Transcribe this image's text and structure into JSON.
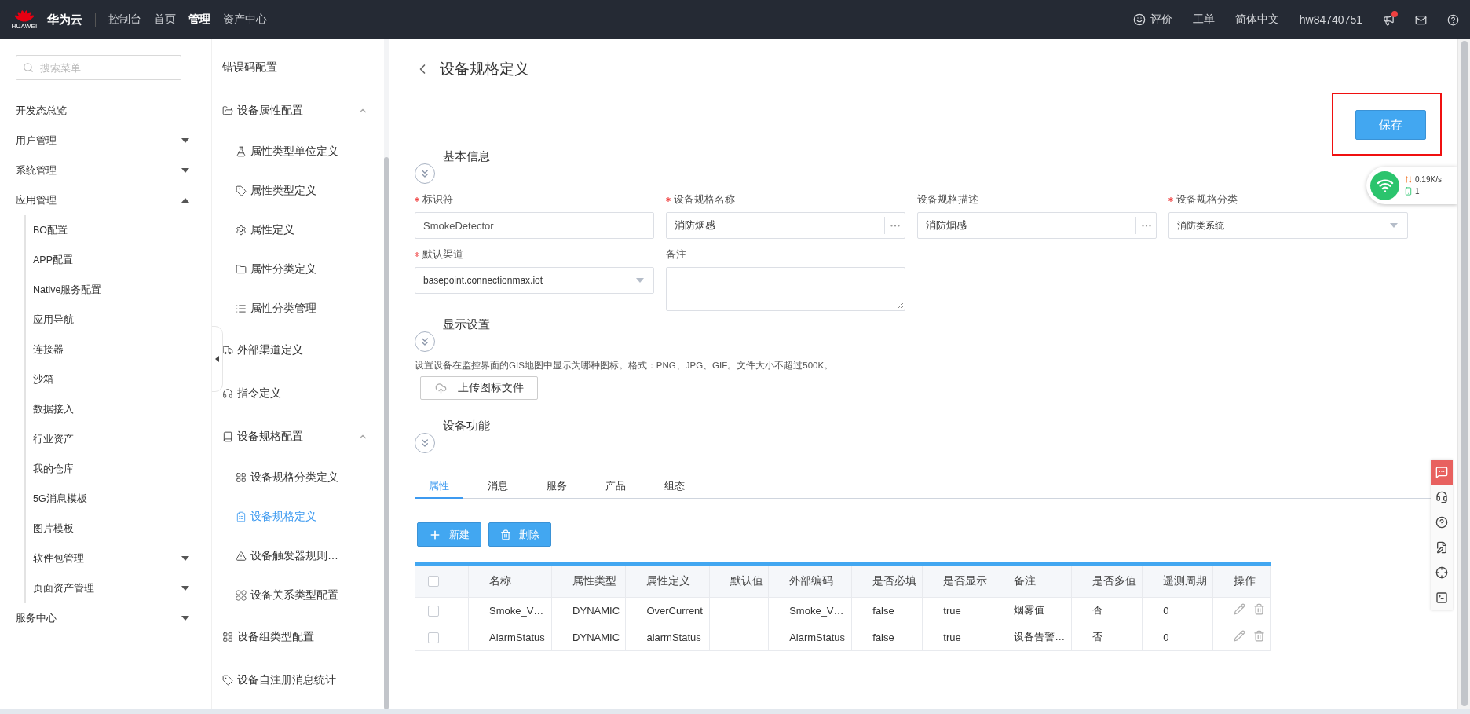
{
  "topbar": {
    "logo_text": "HUAWEI",
    "brand": "华为云",
    "nav": [
      {
        "label": "控制台",
        "selected": false
      },
      {
        "label": "首页",
        "selected": false
      },
      {
        "label": "管理",
        "selected": true
      },
      {
        "label": "资产中心",
        "selected": false
      }
    ],
    "links": [
      "评价",
      "工单",
      "简体中文",
      "hw84740751"
    ],
    "notification_dot": true
  },
  "sidebar": {
    "search_placeholder": "搜索菜单",
    "items": [
      {
        "label": "开发态总览"
      },
      {
        "label": "用户管理",
        "expanded": false
      },
      {
        "label": "系统管理",
        "expanded": false
      },
      {
        "label": "应用管理",
        "expanded": true,
        "children": [
          {
            "label": "BO配置"
          },
          {
            "label": "APP配置"
          },
          {
            "label": "Native服务配置"
          },
          {
            "label": "应用导航"
          },
          {
            "label": "连接器"
          },
          {
            "label": "沙箱"
          },
          {
            "label": "数据接入"
          },
          {
            "label": "行业资产"
          },
          {
            "label": "我的仓库"
          },
          {
            "label": "5G消息模板"
          },
          {
            "label": "图片模板"
          },
          {
            "label": "软件包管理",
            "expanded": false
          },
          {
            "label": "页面资产管理",
            "expanded": false
          }
        ]
      },
      {
        "label": "服务中心",
        "expanded": false
      }
    ]
  },
  "subnav": {
    "items": [
      {
        "label": "错误码配置",
        "selected": false
      },
      {
        "label": "设备属性配置",
        "selected": false,
        "expanded": true,
        "children": [
          {
            "label": "属性类型单位定义",
            "selected": false
          },
          {
            "label": "属性类型定义",
            "selected": false
          },
          {
            "label": "属性定义",
            "selected": false
          },
          {
            "label": "属性分类定义",
            "selected": false
          },
          {
            "label": "属性分类管理",
            "selected": false
          }
        ]
      },
      {
        "label": "外部渠道定义",
        "selected": false
      },
      {
        "label": "指令定义",
        "selected": false
      },
      {
        "label": "设备规格配置",
        "selected": false,
        "expanded": true,
        "children": [
          {
            "label": "设备规格分类定义",
            "selected": false
          },
          {
            "label": "设备规格定义",
            "selected": true
          },
          {
            "label": "设备触发器规则…",
            "selected": false
          },
          {
            "label": "设备关系类型配置",
            "selected": false
          }
        ]
      },
      {
        "label": "设备组类型配置",
        "selected": false
      },
      {
        "label": "设备自注册消息统计",
        "selected": false
      }
    ]
  },
  "page": {
    "title": "设备规格定义",
    "save_button": {
      "label": "保存",
      "highlighted": true
    },
    "network_widget": {
      "speed": "0.19K/s",
      "count": "1"
    },
    "basic": {
      "title": "基本信息",
      "fields": [
        {
          "label": "标识符",
          "required": true,
          "kind": "text",
          "value": "SmokeDetector",
          "disabled": true
        },
        {
          "label": "设备规格名称",
          "required": true,
          "kind": "picker",
          "value": "消防烟感",
          "disabled": false
        },
        {
          "label": "设备规格描述",
          "required": false,
          "kind": "picker",
          "value": "消防烟感",
          "disabled": false
        },
        {
          "label": "设备规格分类",
          "required": true,
          "kind": "select",
          "value": "消防类系统",
          "disabled": false
        },
        {
          "label": "默认渠道",
          "required": true,
          "kind": "select",
          "value": "basepoint.connectionmax.iot",
          "disabled": false
        },
        {
          "label": "备注",
          "required": false,
          "kind": "textarea"
        }
      ]
    },
    "display": {
      "title": "显示设置",
      "hint": "设置设备在监控界面的GIS地图中显示为哪种图标。格式：PNG、JPG、GIF。文件大小不超过500K。",
      "upload_button": "上传图标文件"
    },
    "functions": {
      "title": "设备功能",
      "tabs": [
        {
          "label": "属性",
          "selected": true
        },
        {
          "label": "消息",
          "selected": false
        },
        {
          "label": "服务",
          "selected": false
        },
        {
          "label": "产品",
          "selected": false
        },
        {
          "label": "组态",
          "selected": false
        }
      ],
      "buttons": [
        {
          "kind": "add",
          "label": "新建"
        },
        {
          "kind": "delete",
          "label": "删除"
        }
      ],
      "table": {
        "all_checked": false,
        "columns": [
          "名称",
          "属性类型",
          "属性定义",
          "默认值",
          "外部编码",
          "是否必填",
          "是否显示",
          "备注",
          "是否多值",
          "遥测周期",
          "操作"
        ],
        "rows": [
          {
            "checked": false,
            "cells": [
              "Smoke_V…",
              "DYNAMIC",
              "OverCurrent",
              "",
              "Smoke_V…",
              "false",
              "true",
              "烟雾值",
              "否",
              "0"
            ]
          },
          {
            "checked": false,
            "cells": [
              "AlarmStatus",
              "DYNAMIC",
              "alarmStatus",
              "",
              "AlarmStatus",
              "false",
              "true",
              "设备告警…",
              "否",
              "0"
            ]
          }
        ]
      }
    }
  }
}
